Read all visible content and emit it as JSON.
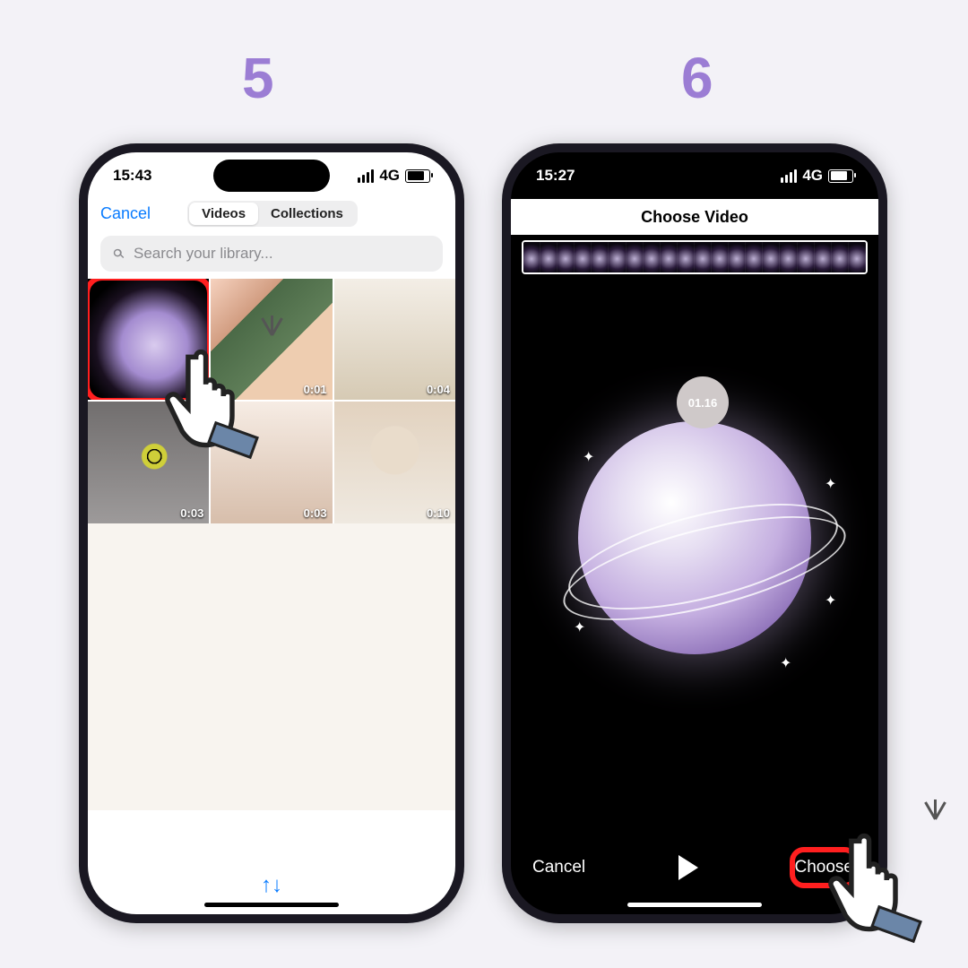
{
  "steps": {
    "s5": "5",
    "s6": "6"
  },
  "left": {
    "time": "15:43",
    "network": "4G",
    "cancel": "Cancel",
    "tabs": {
      "videos": "Videos",
      "collections": "Collections"
    },
    "search_placeholder": "Search your library...",
    "thumbs": [
      {
        "d": ""
      },
      {
        "d": "0:01"
      },
      {
        "d": "0:04"
      },
      {
        "d": "0:03"
      },
      {
        "d": "0:03"
      },
      {
        "d": "0:10"
      }
    ],
    "sort_glyph": "↑↓"
  },
  "right": {
    "time": "15:27",
    "network": "4G",
    "title": "Choose Video",
    "badge": "01.16",
    "cancel": "Cancel",
    "choose": "Choose"
  }
}
